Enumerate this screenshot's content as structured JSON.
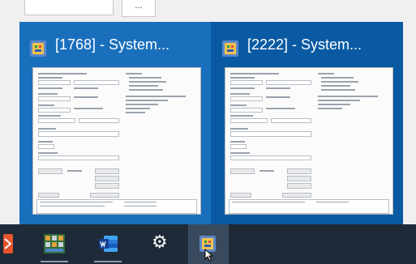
{
  "desktop": {
    "more_label": "..."
  },
  "thumbnails": [
    {
      "title": "[1768] - System..."
    },
    {
      "title": "[2222] - System..."
    }
  ],
  "taskbar": {
    "items": [
      {
        "icon": "app-orange-icon"
      },
      {
        "icon": "grid-app-icon"
      },
      {
        "icon": "word-icon"
      },
      {
        "icon": "settings-gear-icon"
      },
      {
        "icon": "system-app-icon"
      }
    ]
  },
  "colors": {
    "flyout_bg": "#0b5ea7",
    "taskbar_bg": "#1f2a38",
    "active_card": "#1a6fbc"
  }
}
